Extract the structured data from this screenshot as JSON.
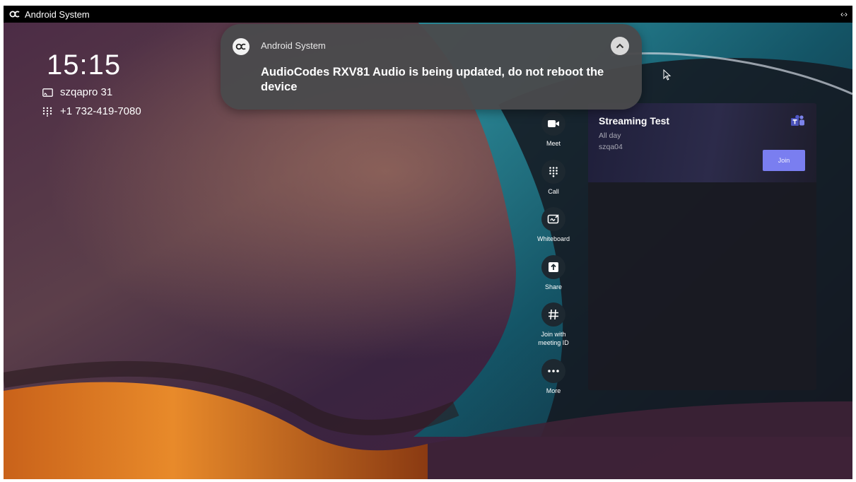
{
  "statusbar": {
    "app_name": "Android System",
    "right_icon": "‹·›"
  },
  "home": {
    "time": "15:15",
    "room_name": "szqapro 31",
    "phone_number": "+1 732-419-7080"
  },
  "notification": {
    "app_name": "Android System",
    "message": "AudioCodes RXV81 Audio is being updated, do not reboot the device",
    "expand_icon": "chevron-up-icon"
  },
  "actions": [
    {
      "label": "Meet",
      "icon": "video-camera-icon"
    },
    {
      "label": "Call",
      "icon": "dialpad-icon"
    },
    {
      "label": "Whiteboard",
      "icon": "whiteboard-icon"
    },
    {
      "label": "Share",
      "icon": "share-icon"
    },
    {
      "label": "Join with meeting ID",
      "icon": "hash-icon"
    },
    {
      "label": "More",
      "icon": "more-icon"
    }
  ],
  "meeting": {
    "title": "Streaming Test",
    "time": "All day",
    "organizer": "szqa04",
    "join_label": "Join"
  },
  "colors": {
    "join_button": "#7a7ef0",
    "notification_bg": "#4a4a4c",
    "action_circle": "#1d2830"
  }
}
